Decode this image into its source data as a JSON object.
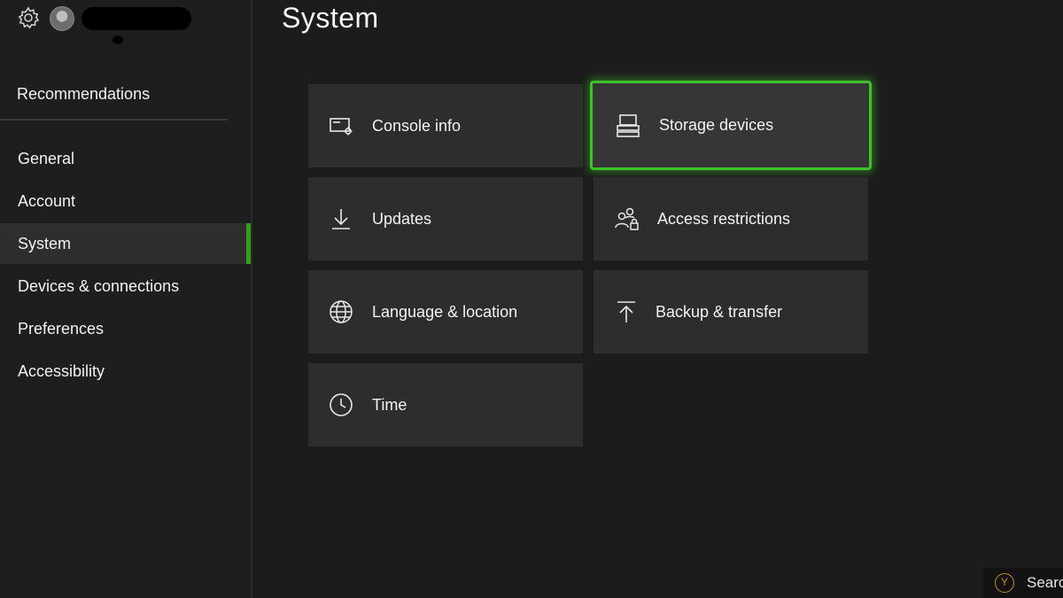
{
  "sidebar": {
    "recommendations_label": "Recommendations",
    "items": [
      {
        "label": "General",
        "active": false
      },
      {
        "label": "Account",
        "active": false
      },
      {
        "label": "System",
        "active": true
      },
      {
        "label": "Devices & connections",
        "active": false
      },
      {
        "label": "Preferences",
        "active": false
      },
      {
        "label": "Accessibility",
        "active": false
      }
    ]
  },
  "page": {
    "title": "System"
  },
  "tiles": [
    {
      "label": "Console info",
      "icon": "console-info-icon",
      "focused": false
    },
    {
      "label": "Storage devices",
      "icon": "storage-icon",
      "focused": true
    },
    {
      "label": "Updates",
      "icon": "download-icon",
      "focused": false
    },
    {
      "label": "Access restrictions",
      "icon": "people-lock-icon",
      "focused": false
    },
    {
      "label": "Language & location",
      "icon": "globe-icon",
      "focused": false
    },
    {
      "label": "Backup & transfer",
      "icon": "upload-icon",
      "focused": false
    },
    {
      "label": "Time",
      "icon": "clock-icon",
      "focused": false
    }
  ],
  "hint": {
    "button": "Y",
    "label": "Searc"
  },
  "colors": {
    "accent": "#3fc12c",
    "background": "#1c1c1c",
    "tile": "#2d2d2d",
    "y_button": "#c98b2e"
  }
}
